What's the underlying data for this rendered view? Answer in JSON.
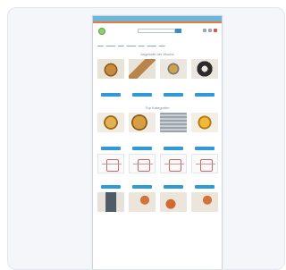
{
  "section_titles": {
    "featured": "Angebote der Woche",
    "categories": "Top Kategorien"
  },
  "icons": [
    "logo-mark-icon",
    "search-icon",
    "cart-icon",
    "account-icon"
  ],
  "colors": {
    "brand_blue": "#2e6da4",
    "accent_orange": "#e97a3a",
    "button_blue": "#2f9bd6"
  }
}
